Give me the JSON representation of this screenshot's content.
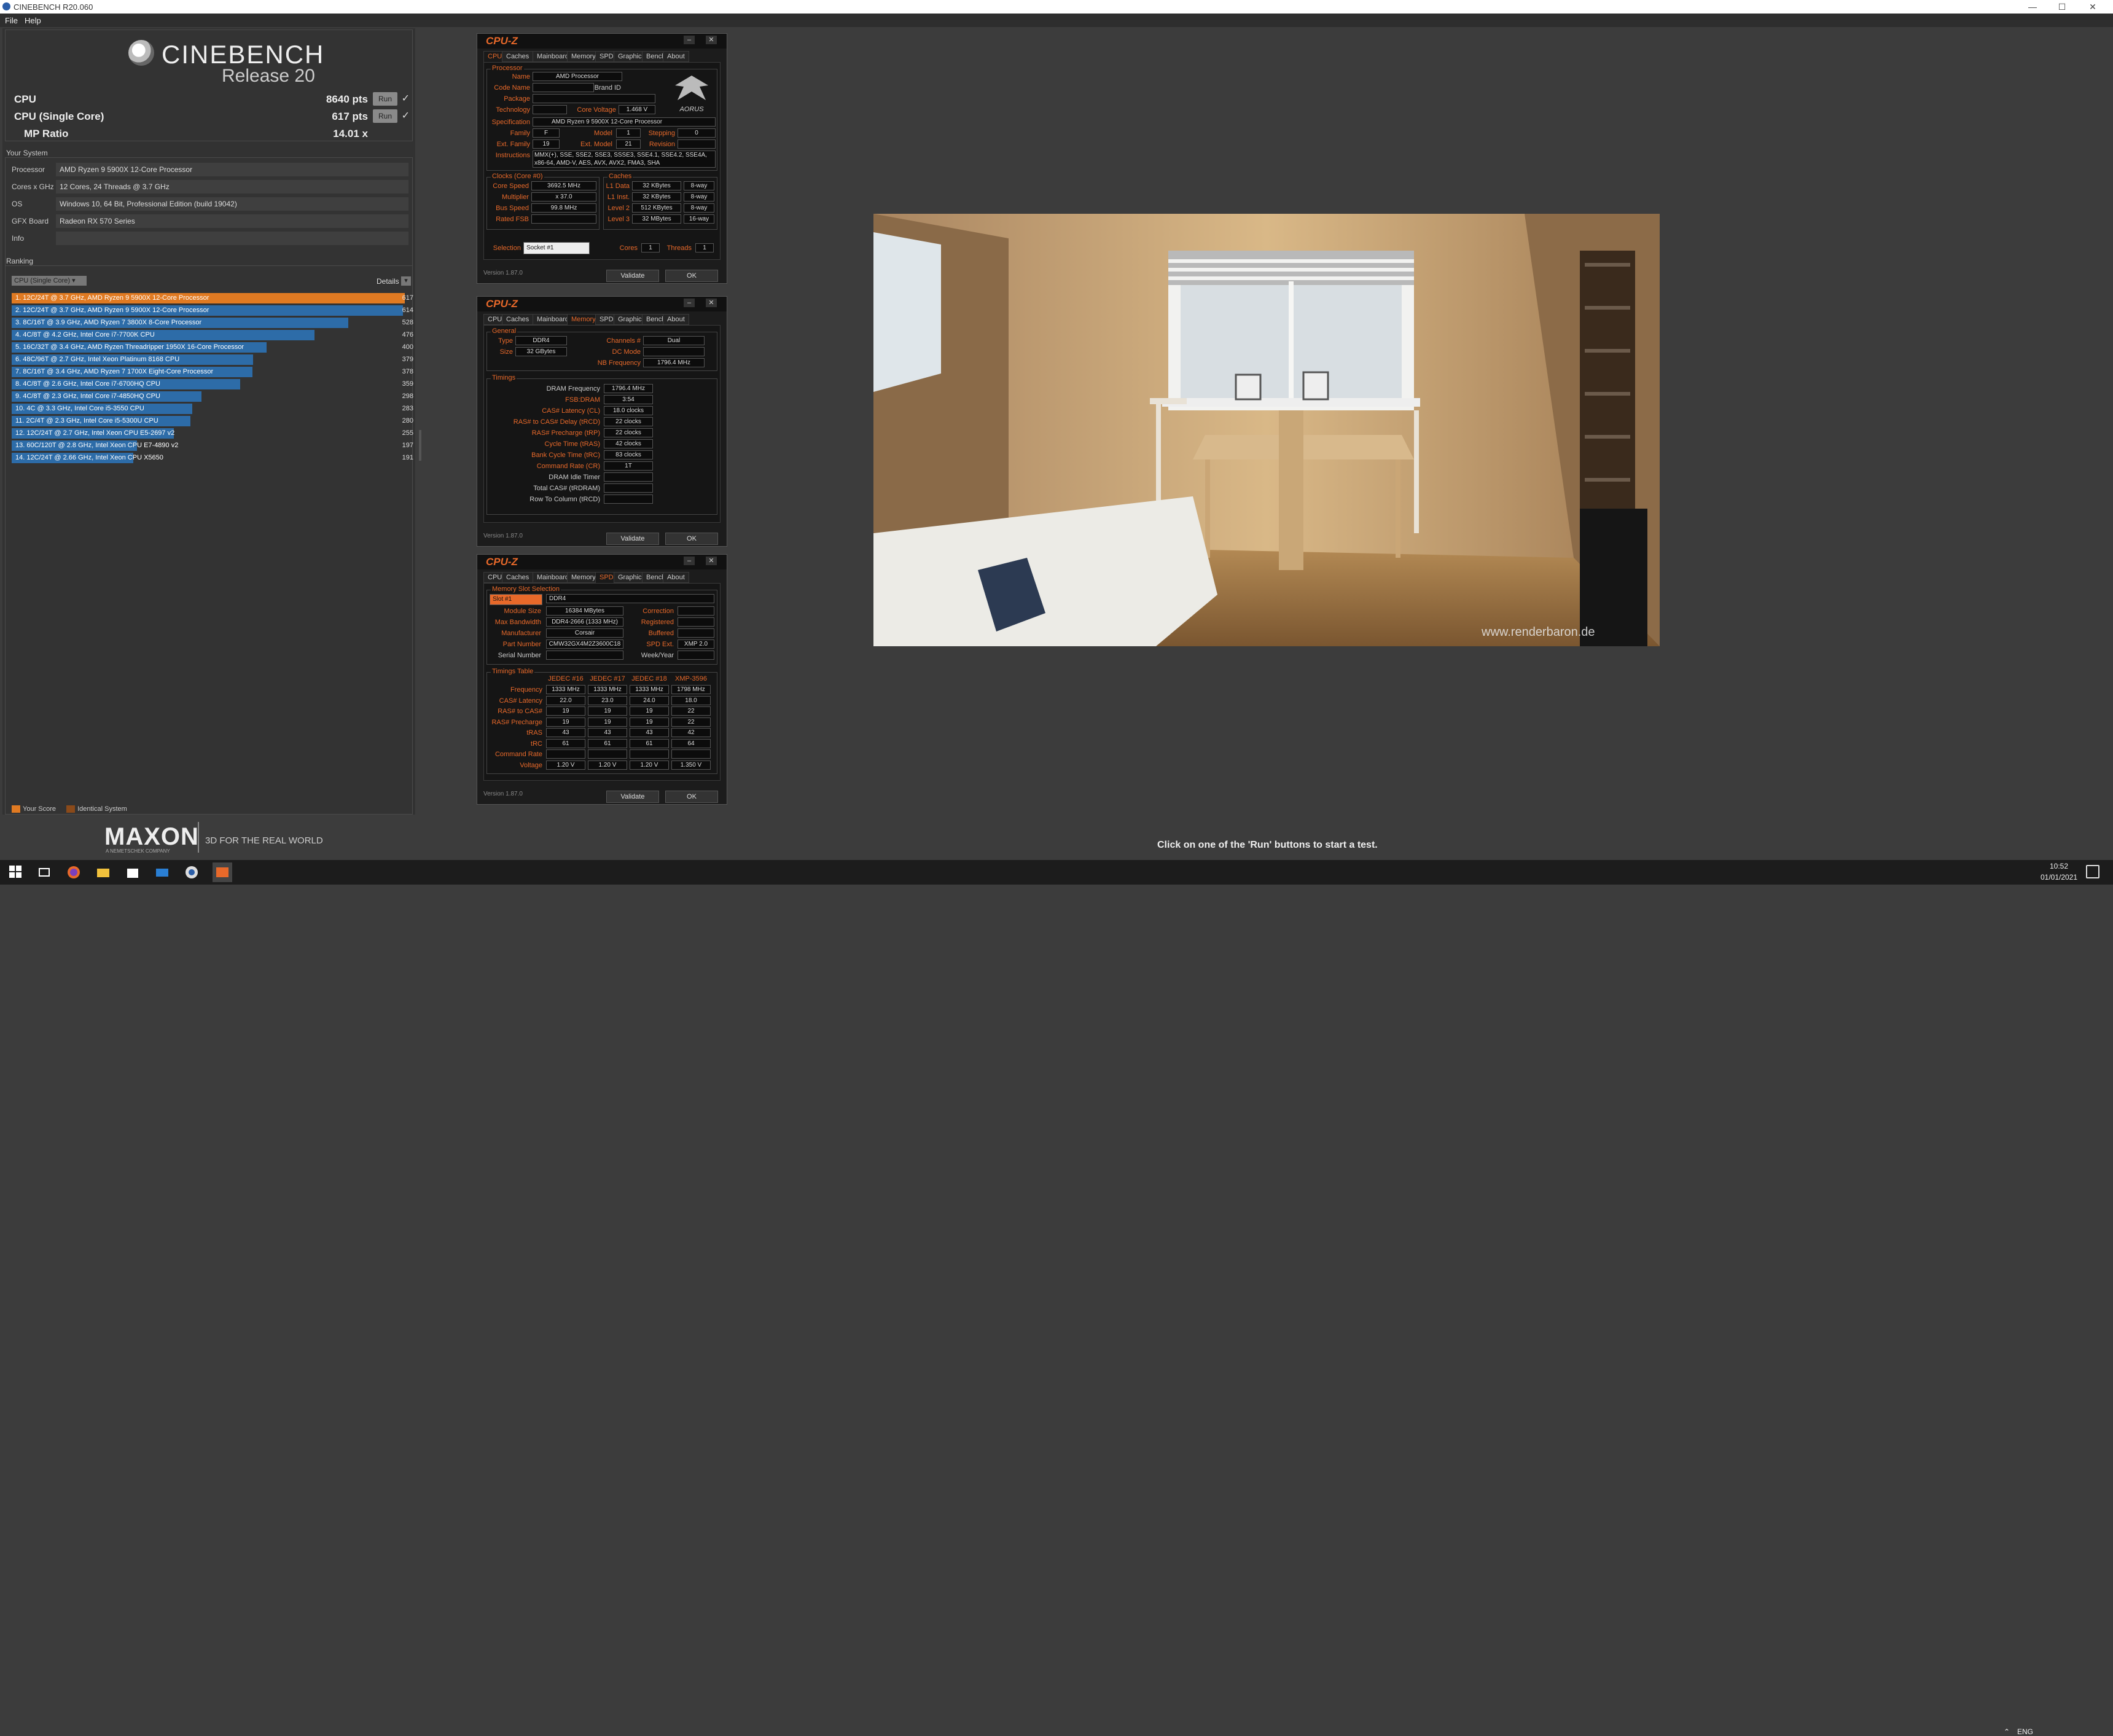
{
  "window": {
    "title": "CINEBENCH R20.060",
    "min": "—",
    "max": "☐",
    "close": "✕"
  },
  "menu": {
    "file": "File",
    "help": "Help"
  },
  "logo": {
    "word": "CINEBENCH",
    "release": "Release 20"
  },
  "scores": [
    {
      "label": "CPU",
      "value": "8640 pts",
      "run": "Run",
      "check": "✓"
    },
    {
      "label": "CPU (Single Core)",
      "value": "617 pts",
      "run": "Run",
      "check": "✓"
    },
    {
      "label": "MP Ratio",
      "value": "14.01 x"
    }
  ],
  "system": {
    "title": "Your System",
    "rows": [
      {
        "k": "Processor",
        "v": "AMD Ryzen 9 5900X 12-Core Processor"
      },
      {
        "k": "Cores x GHz",
        "v": "12 Cores, 24 Threads @ 3.7 GHz"
      },
      {
        "k": "OS",
        "v": "Windows 10, 64 Bit, Professional Edition (build 19042)"
      },
      {
        "k": "GFX Board",
        "v": "Radeon RX 570 Series"
      },
      {
        "k": "Info",
        "v": ""
      }
    ]
  },
  "ranking": {
    "title": "Ranking",
    "select": "CPU (Single Core) ▾",
    "details": "Details",
    "details_x": "▾",
    "rows": [
      {
        "t": "1. 12C/24T @ 3.7 GHz, AMD Ryzen 9 5900X 12-Core Processor",
        "s": "617",
        "frac": 1.0,
        "c": "#e07a22"
      },
      {
        "t": "2. 12C/24T @ 3.7 GHz, AMD Ryzen 9 5900X 12-Core Processor",
        "s": "614",
        "frac": 0.995,
        "c": "#2d6ca8"
      },
      {
        "t": "3. 8C/16T @ 3.9 GHz, AMD Ryzen 7 3800X 8-Core Processor",
        "s": "528",
        "frac": 0.856,
        "c": "#2d6ca8"
      },
      {
        "t": "4. 4C/8T @ 4.2 GHz, Intel Core i7-7700K CPU",
        "s": "476",
        "frac": 0.771,
        "c": "#2d6ca8"
      },
      {
        "t": "5. 16C/32T @ 3.4 GHz, AMD Ryzen Threadripper 1950X 16-Core Processor",
        "s": "400",
        "frac": 0.648,
        "c": "#2d6ca8"
      },
      {
        "t": "6. 48C/96T @ 2.7 GHz, Intel Xeon Platinum 8168 CPU",
        "s": "379",
        "frac": 0.614,
        "c": "#2d6ca8"
      },
      {
        "t": "7. 8C/16T @ 3.4 GHz, AMD Ryzen 7 1700X Eight-Core Processor",
        "s": "378",
        "frac": 0.613,
        "c": "#2d6ca8"
      },
      {
        "t": "8. 4C/8T @ 2.6 GHz, Intel Core i7-6700HQ CPU",
        "s": "359",
        "frac": 0.582,
        "c": "#2d6ca8"
      },
      {
        "t": "9. 4C/8T @ 2.3 GHz, Intel Core i7-4850HQ CPU",
        "s": "298",
        "frac": 0.483,
        "c": "#2d6ca8"
      },
      {
        "t": "10. 4C @ 3.3 GHz, Intel Core i5-3550 CPU",
        "s": "283",
        "frac": 0.459,
        "c": "#2d6ca8"
      },
      {
        "t": "11. 2C/4T @ 2.3 GHz, Intel Core i5-5300U CPU",
        "s": "280",
        "frac": 0.454,
        "c": "#2d6ca8"
      },
      {
        "t": "12. 12C/24T @ 2.7 GHz, Intel Xeon CPU E5-2697 v2",
        "s": "255",
        "frac": 0.413,
        "c": "#2d6ca8"
      },
      {
        "t": "13. 60C/120T @ 2.8 GHz, Intel Xeon CPU E7-4890 v2",
        "s": "197",
        "frac": 0.319,
        "c": "#2d6ca8"
      },
      {
        "t": "14. 12C/24T @ 2.66 GHz, Intel Xeon CPU X5650",
        "s": "191",
        "frac": 0.31,
        "c": "#2d6ca8"
      }
    ],
    "legend": {
      "your": "Your Score",
      "ident": "Identical System",
      "your_c": "#e07a22",
      "ident_c": "#8a4a1a"
    }
  },
  "brand": {
    "maxon": "MAXON",
    "sub": "A NEMETSCHEK COMPANY",
    "tag": "3D FOR THE REAL WORLD"
  },
  "status": "Click on one of the 'Run' buttons to start a test.",
  "render": {
    "watermark": "www.renderbaron.de"
  },
  "cpuz": {
    "title": "CPU-Z",
    "version": "Version 1.87.0",
    "validate": "Validate",
    "ok": "OK",
    "tabs": [
      "CPU",
      "Caches",
      "Mainboard",
      "Memory",
      "SPD",
      "Graphics",
      "Bench",
      "About"
    ],
    "cpu": {
      "grp_processor": "Processor",
      "name_l": "Name",
      "name": "AMD Processor",
      "code_l": "Code Name",
      "code": "",
      "brand": "Brand ID",
      "pkg_l": "Package",
      "pkg": "",
      "tech_l": "Technology",
      "tech": "",
      "cv_l": "Core Voltage",
      "cv": "1.468 V",
      "spec_l": "Specification",
      "spec": "AMD Ryzen 9 5900X 12-Core Processor",
      "fam_l": "Family",
      "fam": "F",
      "model_l": "Model",
      "model": "1",
      "step_l": "Stepping",
      "step": "0",
      "efam_l": "Ext. Family",
      "efam": "19",
      "emodel_l": "Ext. Model",
      "emodel": "21",
      "rev_l": "Revision",
      "rev": "",
      "ins_l": "Instructions",
      "ins": "MMX(+), SSE, SSE2, SSE3, SSSE3, SSE4.1, SSE4.2, SSE4A, x86-64, AMD-V, AES, AVX, AVX2, FMA3, SHA",
      "grp_clocks": "Clocks (Core #0)",
      "grp_caches": "Caches",
      "cs_l": "Core Speed",
      "cs": "3692.5 MHz",
      "mul_l": "Multiplier",
      "mul": "x 37.0",
      "bus_l": "Bus Speed",
      "bus": "99.8 MHz",
      "fsb_l": "Rated FSB",
      "fsb": "",
      "l1d_l": "L1 Data",
      "l1d": "32 KBytes",
      "l1d_w": "8-way",
      "l1i_l": "L1 Inst.",
      "l1i": "32 KBytes",
      "l1i_w": "8-way",
      "l2_l": "Level 2",
      "l2": "512 KBytes",
      "l2_w": "8-way",
      "l3_l": "Level 3",
      "l3": "32 MBytes",
      "l3_w": "16-way",
      "sel_l": "Selection",
      "sel": "Socket #1",
      "cores_l": "Cores",
      "cores": "1",
      "thr_l": "Threads",
      "thr": "1",
      "aorus": "AORUS"
    },
    "mem": {
      "grp_general": "General",
      "type_l": "Type",
      "type": "DDR4",
      "ch_l": "Channels #",
      "ch": "Dual",
      "size_l": "Size",
      "size": "32 GBytes",
      "dc_l": "DC Mode",
      "dc": "",
      "nb_l": "NB Frequency",
      "nb": "1796.4 MHz",
      "grp_timings": "Timings",
      "rows": [
        {
          "l": "DRAM Frequency",
          "v": "1796.4 MHz",
          "w": true
        },
        {
          "l": "FSB:DRAM",
          "v": "3:54"
        },
        {
          "l": "CAS# Latency (CL)",
          "v": "18.0 clocks"
        },
        {
          "l": "RAS# to CAS# Delay (tRCD)",
          "v": "22 clocks"
        },
        {
          "l": "RAS# Precharge (tRP)",
          "v": "22 clocks"
        },
        {
          "l": "Cycle Time (tRAS)",
          "v": "42 clocks"
        },
        {
          "l": "Bank Cycle Time (tRC)",
          "v": "83 clocks"
        },
        {
          "l": "Command Rate (CR)",
          "v": "1T"
        },
        {
          "l": "DRAM Idle Timer",
          "v": "",
          "w": true
        },
        {
          "l": "Total CAS# (tRDRAM)",
          "v": "",
          "w": true
        },
        {
          "l": "Row To Column (tRCD)",
          "v": "",
          "w": true
        }
      ]
    },
    "spd": {
      "grp_slot": "Memory Slot Selection",
      "slot": "Slot #1",
      "slot_type": "DDR4",
      "ms_l": "Module Size",
      "ms": "16384 MBytes",
      "corr_l": "Correction",
      "corr": "",
      "mb_l": "Max Bandwidth",
      "mb": "DDR4-2666 (1333 MHz)",
      "reg_l": "Registered",
      "reg": "",
      "man_l": "Manufacturer",
      "man": "Corsair",
      "buf_l": "Buffered",
      "buf": "",
      "pn_l": "Part Number",
      "pn": "CMW32GX4M2Z3600C18",
      "spdext_l": "SPD Ext.",
      "spdext": "XMP 2.0",
      "sn_l": "Serial Number",
      "sn": "",
      "wy_l": "Week/Year",
      "wy": "",
      "grp_tt": "Timings Table",
      "cols": [
        "JEDEC #16",
        "JEDEC #17",
        "JEDEC #18",
        "XMP-3596"
      ],
      "trows": [
        {
          "l": "Frequency",
          "v": [
            "1333 MHz",
            "1333 MHz",
            "1333 MHz",
            "1798 MHz"
          ]
        },
        {
          "l": "CAS# Latency",
          "v": [
            "22.0",
            "23.0",
            "24.0",
            "18.0"
          ]
        },
        {
          "l": "RAS# to CAS#",
          "v": [
            "19",
            "19",
            "19",
            "22"
          ]
        },
        {
          "l": "RAS# Precharge",
          "v": [
            "19",
            "19",
            "19",
            "22"
          ]
        },
        {
          "l": "tRAS",
          "v": [
            "43",
            "43",
            "43",
            "42"
          ]
        },
        {
          "l": "tRC",
          "v": [
            "61",
            "61",
            "61",
            "64"
          ]
        },
        {
          "l": "Command Rate",
          "v": [
            "",
            "",
            "",
            ""
          ]
        },
        {
          "l": "Voltage",
          "v": [
            "1.20 V",
            "1.20 V",
            "1.20 V",
            "1.350 V"
          ]
        }
      ]
    }
  },
  "taskbar": {
    "lang": "ENG",
    "time": "10:52",
    "date": "01/01/2021"
  }
}
